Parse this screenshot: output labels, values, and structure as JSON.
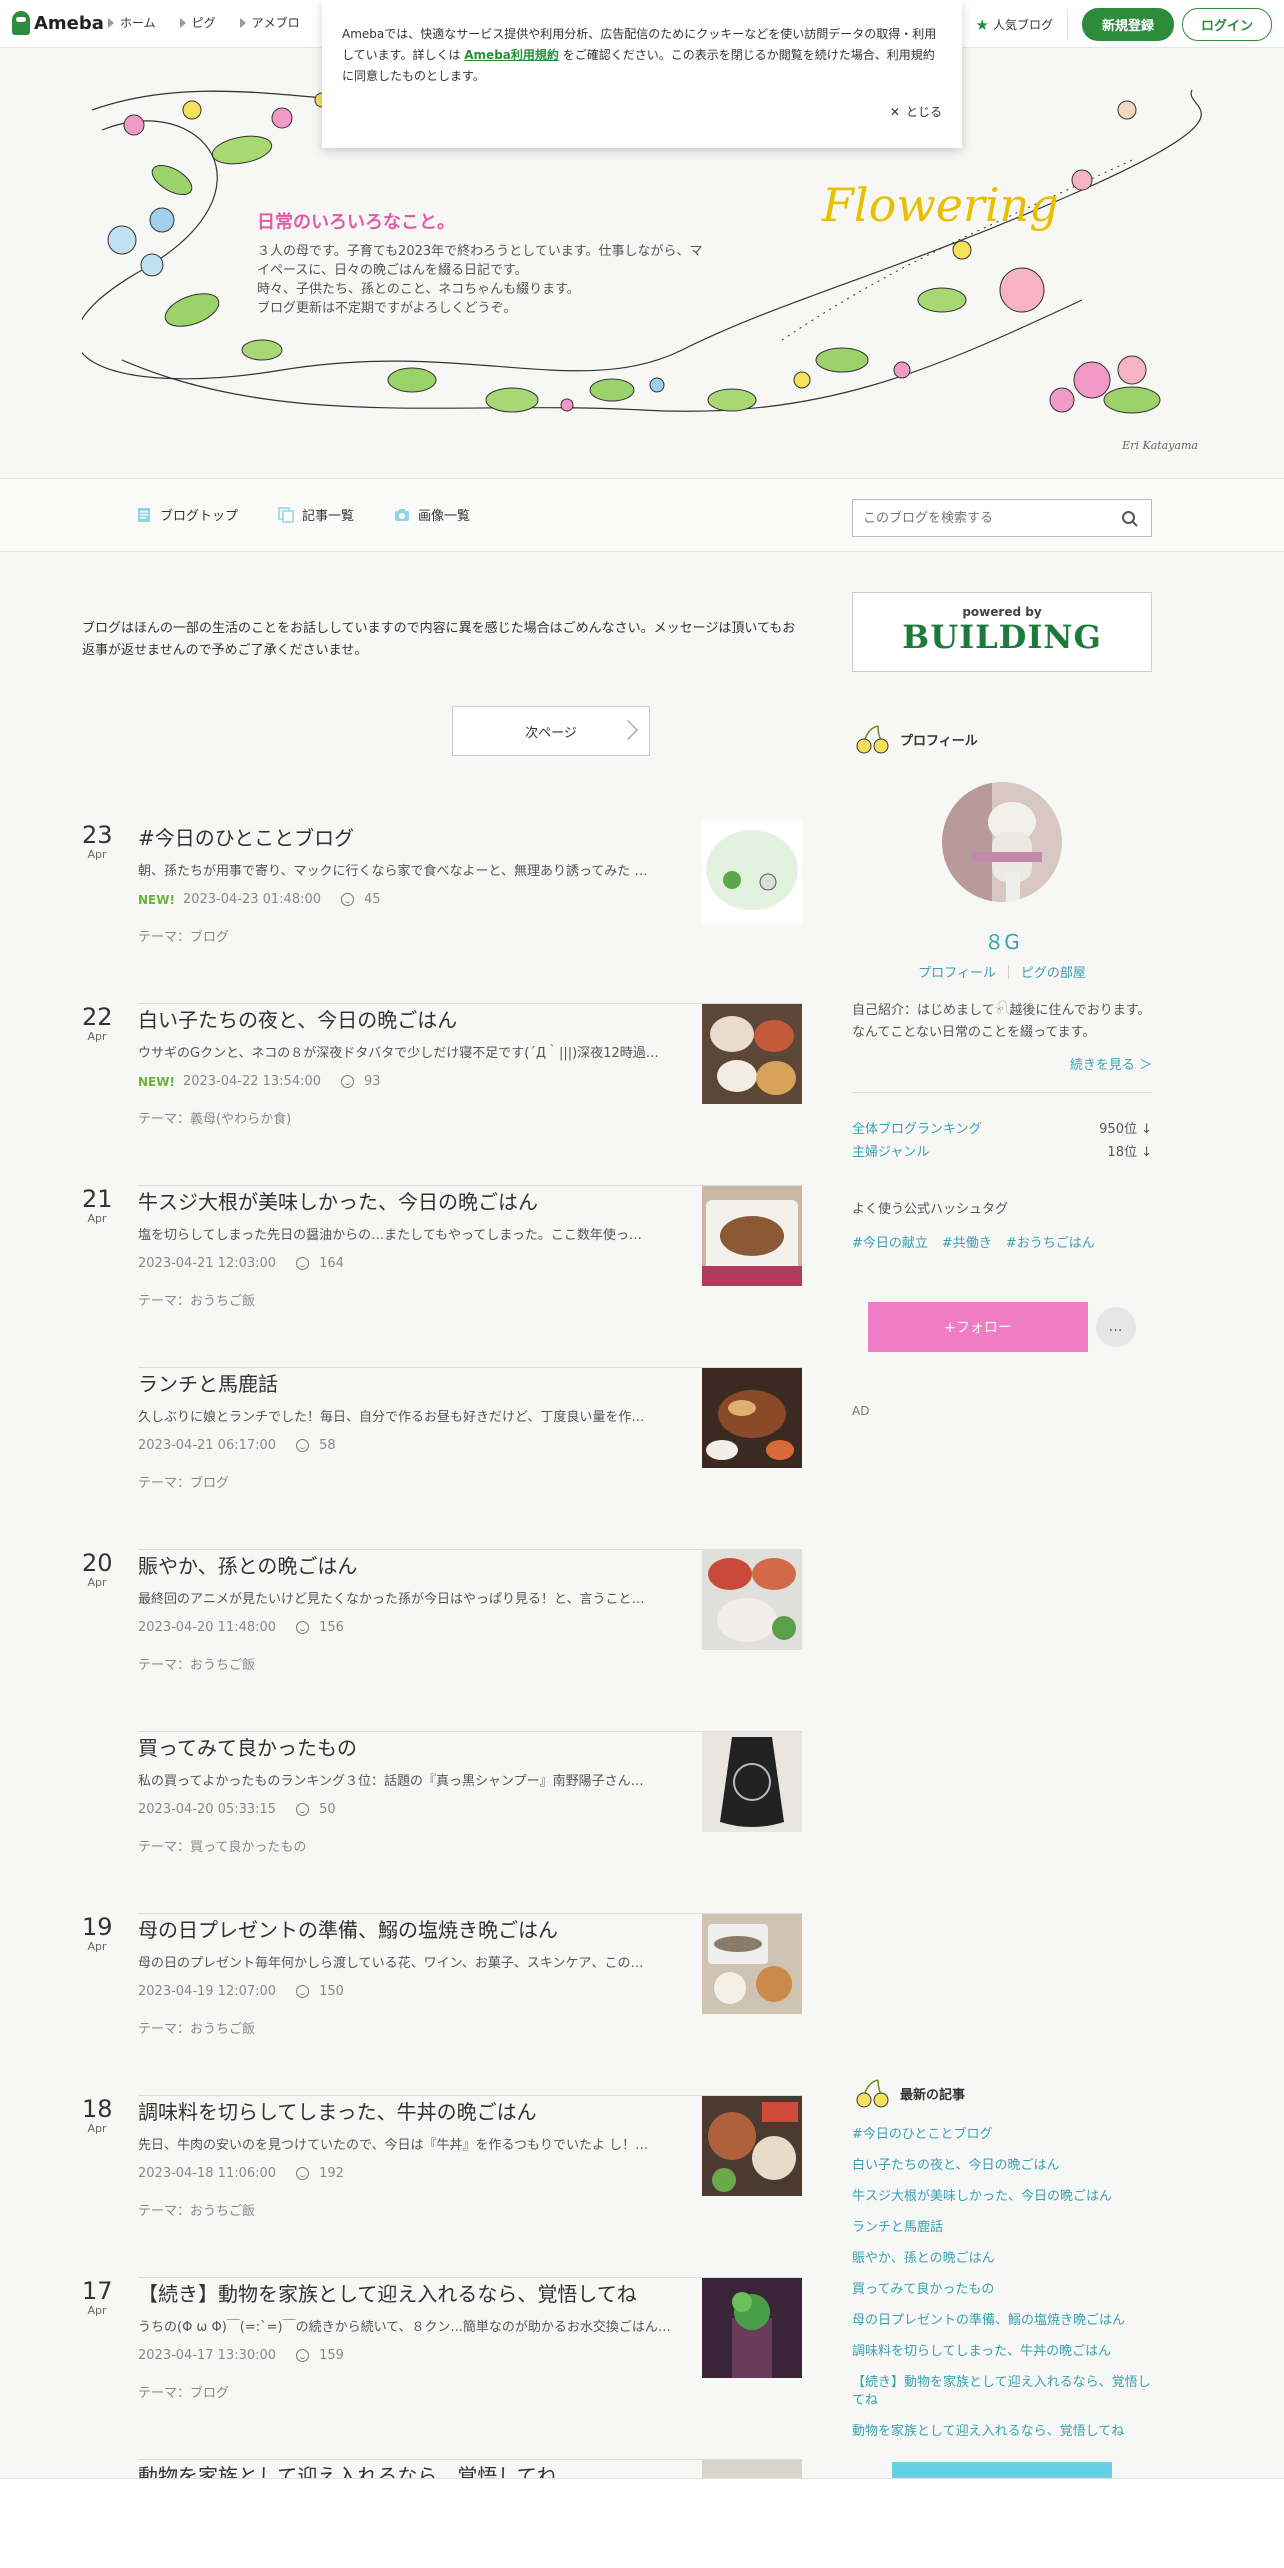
{
  "header": {
    "logo_text": "Ameba",
    "nav": [
      "ホーム",
      "ピグ",
      "アメブロ"
    ],
    "popular_blog": "人気ブログ",
    "register": "新規登録",
    "login": "ログイン"
  },
  "cookie": {
    "text_before": "Amebaでは、快適なサービス提供や利用分析、広告配信のためにクッキーなどを使い訪問データの取得・利用しています。詳しくは ",
    "link": "Ameba利用規約",
    "text_after": " をご確認ください。この表示を閉じるか閲覧を続けた場合、利用規約に同意したものとします。",
    "close": "とじる"
  },
  "blog": {
    "title": "日常のいろいろなこと。",
    "desc": [
      "３人の母です。子育ても2023年で終わろうとしています。仕事しながら、マ",
      "イペースに、日々の晩ごはんを綴る日記です。",
      "時々、子供たち、孫とのこと、ネコちゃんも綴ります。",
      "ブログ更新は不定期ですがよろしくどうぞ。"
    ],
    "banner_script": "Flowering",
    "credit": "Eri Katayama"
  },
  "blognav": {
    "items": [
      "ブログトップ",
      "記事一覧",
      "画像一覧"
    ],
    "search_placeholder": "このブログを検索する"
  },
  "notice": "ブログはほんの一部の生活のことをお話ししていますので内容に異を感じた場合はごめんなさい。メッセージは頂いてもお返事が返せませんので予めご了承くださいませ。",
  "next_page": "次ページ",
  "entries": [
    {
      "day": "23",
      "month": "Apr",
      "title": "#今日のひとことブログ",
      "excerpt": "朝、孫たちが用事で寄り、マックに行くなら家で食べなよーと、無理あり誘ってみた …",
      "new": "NEW!",
      "datetime": "2023-04-23 01:48:00",
      "likes": "45",
      "theme": "テーマ：ブログ",
      "thumb": "illust"
    },
    {
      "day": "22",
      "month": "Apr",
      "title": "白い子たちの夜と、今日の晩ごはん",
      "excerpt": "ウサギのGクンと、ネコの８が深夜ドタバタで少しだけ寝不足です(´Д｀|||)深夜12時過…",
      "new": "NEW!",
      "datetime": "2023-04-22 13:54:00",
      "likes": "93",
      "theme": "テーマ：義母(やわらか食)",
      "thumb": "dinner"
    },
    {
      "day": "21",
      "month": "Apr",
      "title": "牛スジ大根が美味しかった、今日の晩ごはん",
      "excerpt": "塩を切らしてしまった先日の醤油からの…またしてもやってしまった。ここ数年使っ…",
      "new": "",
      "datetime": "2023-04-21 12:03:00",
      "likes": "164",
      "theme": "テーマ：おうちご飯",
      "thumb": "fish"
    },
    {
      "day": "",
      "month": "",
      "title": "ランチと馬鹿話",
      "excerpt": "久しぶりに娘とランチでした！毎日、自分で作るお昼も好きだけど、丁度良い量を作…",
      "new": "",
      "datetime": "2023-04-21 06:17:00",
      "likes": "58",
      "theme": "テーマ：ブログ",
      "thumb": "lunch"
    },
    {
      "day": "20",
      "month": "Apr",
      "title": "賑やか、孫との晩ごはん",
      "excerpt": "最終回のアニメが見たいけど見たくなかった孫が今日はやっぱり見る！と、言うこと…",
      "new": "",
      "datetime": "2023-04-20 11:48:00",
      "likes": "156",
      "theme": "テーマ：おうちご飯",
      "thumb": "gyoza"
    },
    {
      "day": "",
      "month": "",
      "title": "買ってみて良かったもの",
      "excerpt": "私の買ってよかったものランキング３位：話題の『真っ黒シャンプー』南野陽子さん…",
      "new": "",
      "datetime": "2023-04-20 05:33:15",
      "likes": "50",
      "theme": "テーマ：買って良かったもの",
      "thumb": "shampoo"
    },
    {
      "day": "19",
      "month": "Apr",
      "title": "母の日プレゼントの準備、鰯の塩焼き晩ごはん",
      "excerpt": "母の日のプレゼント毎年何かしら渡している花、ワイン、お菓子、スキンケア、この…",
      "new": "",
      "datetime": "2023-04-19 12:07:00",
      "likes": "150",
      "theme": "テーマ：おうちご飯",
      "thumb": "sardine"
    },
    {
      "day": "18",
      "month": "Apr",
      "title": "調味料を切らしてしまった、牛丼の晩ごはん",
      "excerpt": "先日、牛肉の安いのを見つけていたので、今日は『牛丼』を作るつもりでいたよ し！…",
      "new": "",
      "datetime": "2023-04-18 11:06:00",
      "likes": "192",
      "theme": "テーマ：おうちご飯",
      "thumb": "gyudon"
    },
    {
      "day": "17",
      "month": "Apr",
      "title": "【続き】動物を家族として迎え入れるなら、覚悟してね",
      "excerpt": "うちの(Φ ω Φ)￣(=:`=)￣の続きから続いて、８クン...簡単なのが助かるお水交換ごはん…",
      "new": "",
      "datetime": "2023-04-17 13:30:00",
      "likes": "159",
      "theme": "テーマ：ブログ",
      "thumb": "plant"
    },
    {
      "day": "",
      "month": "",
      "title": "動物を家族として迎え入れるなら、覚悟してね",
      "excerpt": "",
      "new": "",
      "datetime": "",
      "likes": "",
      "theme": "",
      "thumb": "partial"
    }
  ],
  "sidebar": {
    "building_powered": "powered by",
    "building_name": "BUILDING",
    "profile_head": "プロフィール",
    "name": "８G",
    "links": [
      "プロフィール",
      "ピグの部屋"
    ],
    "intro": "自己紹介：はじめまして𓍯越後に住んでおります。 なんてことない日常のことを綴ってます。",
    "more": "続きを見る ＞",
    "rankings": [
      {
        "label": "全体ブログランキング",
        "value": "950位 ↓"
      },
      {
        "label": "主婦ジャンル",
        "value": "18位 ↓"
      }
    ],
    "hashtag_head": "よく使う公式ハッシュタグ",
    "hashtags": [
      "#今日の献立",
      "#共働き",
      "#おうちごはん"
    ],
    "follow": "+フォロー",
    "more_dots": "…",
    "ad": "AD",
    "recent_head": "最新の記事",
    "recent": [
      "#今日のひとことブログ",
      "白い子たちの夜と、今日の晩ごはん",
      "牛スジ大根が美味しかった、今日の晩ごはん",
      "ランチと馬鹿話",
      "賑やか、孫との晩ごはん",
      "買ってみて良かったもの",
      "母の日プレゼントの準備、鰯の塩焼き晩ごはん",
      "調味料を切らしてしまった、牛丼の晩ごはん",
      "【続き】動物を家族として迎え入れるなら、覚悟してね",
      "動物を家族として迎え入れるなら、覚悟してね"
    ]
  },
  "colors": {
    "ameba_green": "#2d8c3c",
    "link_cyan": "#3aa0b4",
    "follow_pink": "#f07cc6",
    "title_pink": "#e25aa8"
  }
}
